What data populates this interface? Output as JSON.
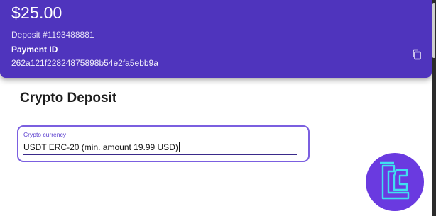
{
  "header": {
    "amount": "$25.00",
    "deposit_id": "Deposit #1193488881",
    "payment_id_label": "Payment ID",
    "payment_id_value": "262a121f22824875898b54e2fa5ebb9a"
  },
  "main": {
    "title": "Crypto Deposit",
    "crypto_field": {
      "label": "Crypto currency",
      "value": "USDT ERC-20 (min. amount 19.99 USD)"
    }
  },
  "icons": {
    "copy": "copy-icon",
    "logo": "tradingfinder-logo"
  },
  "colors": {
    "header_bg": "#4f34bd",
    "accent": "#7b5fe0",
    "logo_bg": "#6a3ae0",
    "logo_mark": "#3fe0f0"
  }
}
